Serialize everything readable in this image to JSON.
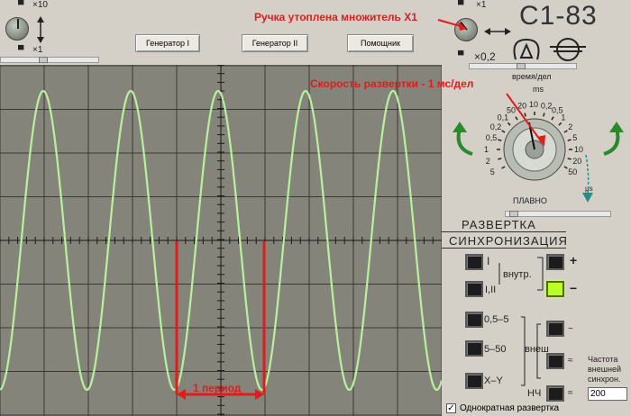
{
  "top": {
    "mult_left_top": "×10",
    "mult_left_bottom": "×1",
    "gen1_label": "Генератор I",
    "gen2_label": "Генератор II",
    "helper_label": "Помощник",
    "mult_right_top": "×1",
    "mult_right_bottom": "×0,2",
    "model": "С1-83",
    "time_div": "время/дел",
    "annotation_knob": "Ручка утоплена множитель X1",
    "annotation_speed": "Скорость развертки - 1 мс/дел"
  },
  "dial": {
    "unit_ms": "ms",
    "unit_us": "μs",
    "smooth": "ПЛАВНО",
    "ticks_left": [
      "10",
      "20",
      "50",
      "0,1",
      "0,2",
      "0,5",
      "1",
      "2",
      "5"
    ],
    "ticks_right": [
      "0,1",
      "0,2",
      "0,5",
      "1",
      "2",
      "5",
      "10",
      "20",
      "50",
      "0,5",
      "1",
      "2"
    ]
  },
  "screen": {
    "period_label": "1 период"
  },
  "sweep": {
    "title": "РАЗВЕРТКА",
    "sync_title": "СИНХРОНИЗАЦИЯ",
    "sync_i": "I",
    "sync_iii": "I,II",
    "internal": "внутр.",
    "plus": "+",
    "minus": "−",
    "r05_5": "0,5–5",
    "r5_50": "5–50",
    "xy": "X–Y",
    "external": "внеш",
    "lf": "НЧ",
    "tilde1": "~",
    "tilde2": "≈",
    "tilde3": "≈",
    "freq_label_1": "Частота",
    "freq_label_2": "внешней",
    "freq_label_3": "синхрон.",
    "freq_value": "200"
  },
  "single_sweep": "Однократная развертка",
  "colors": {
    "trace": "#b8f0a0",
    "grid": "#3a3a34",
    "annotation": "#e31b1b",
    "screen": "#84847a"
  }
}
